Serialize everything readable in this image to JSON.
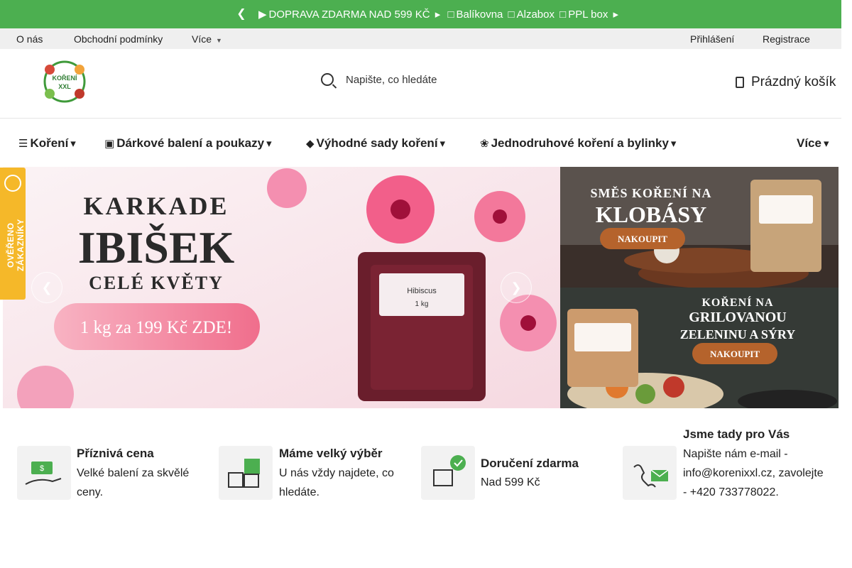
{
  "promo": {
    "text": "DOPRAVA ZDARMA NAD 599 KČ",
    "carriers": [
      "Balíkovna",
      "Alzabox",
      "PPL box"
    ]
  },
  "subnav": {
    "left": [
      "O nás",
      "Obchodní podmínky",
      "Více"
    ],
    "right": [
      "Přihlášení",
      "Registrace"
    ]
  },
  "header": {
    "logo_text": "KOŘENÍ XXL",
    "search_placeholder": "Napište, co hledáte",
    "cart_label": "Prázdný košík"
  },
  "mainnav": {
    "items": [
      "Koření",
      "Dárkové balení a poukazy",
      "Výhodné sady koření",
      "Jednodruhové koření a bylinky",
      "Více"
    ]
  },
  "banners": {
    "main": {
      "line1": "KARKADE",
      "line2": "IBIŠEK",
      "line3": "CELÉ KVĚTY",
      "cta": "1 kg za 199 Kč ZDE!",
      "pack_label": "Hibiscus",
      "pack_weight": "1 kg"
    },
    "side_top": {
      "title_line1": "SMĚS KOŘENÍ NA",
      "title_line2": "KLOBÁSY",
      "cta": "NAKOUPIT"
    },
    "side_bottom": {
      "title_line1": "KOŘENÍ NA",
      "title_line2": "GRILOVANOU",
      "title_line3": "ZELENINU A SÝRY",
      "cta": "NAKOUPIT"
    }
  },
  "badge": {
    "text": "OVĚŘENO ZÁKAZNÍKY"
  },
  "features": [
    {
      "title": "Příznivá cena",
      "text": "Velké balení za skvělé ceny."
    },
    {
      "title": "Máme velký výběr",
      "text": "U nás vždy najdete, co hledáte."
    },
    {
      "title": "Doručení zdarma",
      "text": "Nad 599 Kč"
    },
    {
      "title": "Jsme tady pro Vás",
      "text": "Napište nám e-mail - info@korenixxl.cz, zavolejte - +420 733778022."
    }
  ],
  "colors": {
    "promo_green": "#4caf50",
    "subnav_grey": "#efefef",
    "badge_yellow": "#f5b829",
    "cta_pink": "#f06e8c"
  }
}
